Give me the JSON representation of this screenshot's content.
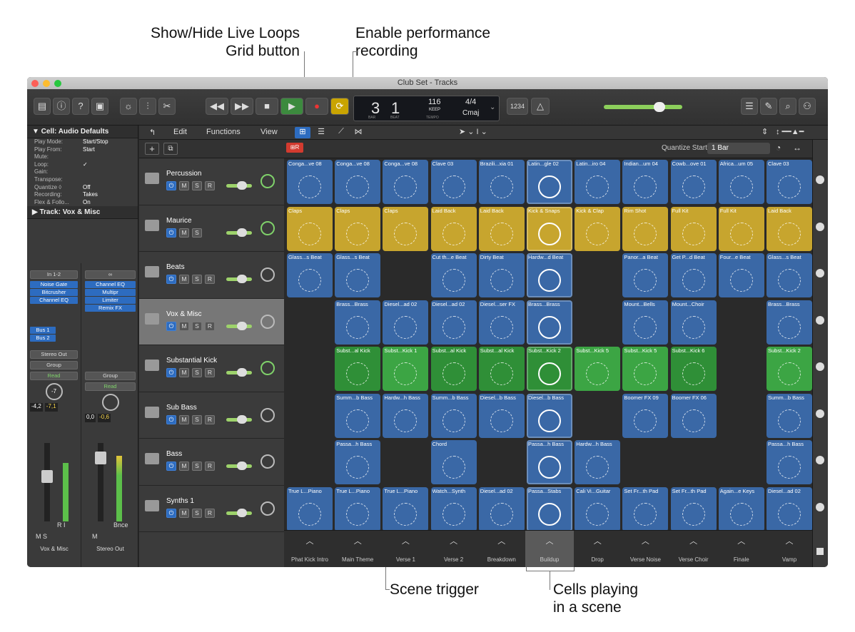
{
  "callouts": {
    "live_loops_grid": "Show/Hide Live Loops\nGrid button",
    "perf_record": "Enable performance\nrecording",
    "scene_trigger": "Scene trigger",
    "cells_playing": "Cells playing\nin a scene"
  },
  "window": {
    "title": "Club Set - Tracks"
  },
  "lcd": {
    "bar": "3",
    "beat": "1",
    "bar_lbl": "BAR",
    "beat_lbl": "BEAT",
    "tempo": "116",
    "keep": "KEEP",
    "tempo_lbl": "TEMPO",
    "sig": "4/4",
    "key": "Cmaj",
    "count": "1234"
  },
  "inspector": {
    "region_header": "▼ Cell: Audio Defaults",
    "rows": [
      {
        "k": "Play Mode:",
        "v": "Start/Stop"
      },
      {
        "k": "Play From:",
        "v": "Start"
      },
      {
        "k": "Mute:",
        "v": ""
      },
      {
        "k": "Loop:",
        "v": "✓"
      },
      {
        "k": "Gain:",
        "v": ""
      },
      {
        "k": "Transpose:",
        "v": ""
      },
      {
        "k": "Quantize ◊",
        "v": "Off"
      },
      {
        "k": "Recording:",
        "v": "Takes"
      },
      {
        "k": "Flex & Follo...",
        "v": "On"
      }
    ],
    "track_header": "▶ Track:  Vox & Misc",
    "ch1": {
      "input": "In 1-2",
      "plugins": [
        "Noise Gate",
        "Bitcrusher",
        "Channel EQ"
      ],
      "sends": [
        "Bus 1",
        "Bus 2"
      ],
      "output": "Stereo Out",
      "group": "Group",
      "auto": "Read",
      "pan": "-7",
      "lvl1": "-4,2",
      "lvl2": "-7,1",
      "name": "Vox & Misc",
      "ri": "R  I",
      "ms": "M  S"
    },
    "ch2": {
      "plugins": [
        "Channel EQ",
        "Multipr",
        "Limiter",
        "Remix FX"
      ],
      "group": "Group",
      "auto": "Read",
      "lvl1": "0,0",
      "lvl2": "-0,6",
      "name": "Stereo Out",
      "bnce": "Bnce",
      "m": "M"
    }
  },
  "menus": {
    "edit": "Edit",
    "functions": "Functions",
    "view": "View",
    "quantize_label": "Quantize Start:",
    "quantize_value": "1 Bar"
  },
  "tracks": [
    {
      "name": "Percussion"
    },
    {
      "name": "Maurice"
    },
    {
      "name": "Beats"
    },
    {
      "name": "Vox & Misc"
    },
    {
      "name": "Substantial Kick"
    },
    {
      "name": "Sub Bass"
    },
    {
      "name": "Bass"
    },
    {
      "name": "Synths 1"
    }
  ],
  "colors": {
    "blue": "#3a68a6",
    "yellow": "#c7a52e",
    "green": "#3ca544",
    "green_dark": "#2f8f37"
  },
  "grid": [
    [
      "Conga...ve 08",
      "Conga...ve 08",
      "Conga...ve 08",
      "Clave 03",
      "Brazili...xia 01",
      "Latin...gle 02",
      "Latin...iro 04",
      "Indian...um 04",
      "Cowb...ove 01",
      "Africa...um 05",
      "Clave 03"
    ],
    [
      "Claps",
      "Claps",
      "Claps",
      "Laid Back",
      "Laid Back",
      "Kick & Snaps",
      "Kick & Clap",
      "Rim Shot",
      "Full Kit",
      "Full Kit",
      "Laid Back"
    ],
    [
      "Glass...s Beat",
      "Glass...s Beat",
      "",
      "Cut th...e Beat",
      "Dirty Beat",
      "Hardw...d Beat",
      "",
      "Panor...a Beat",
      "Get P...d Beat",
      "Four...e Beat",
      "Glass...s Beat"
    ],
    [
      "",
      "Brass...Brass",
      "Diesel...ad 02",
      "Diesel...ad 02",
      "Diesel...ser FX",
      "Brass...Brass",
      "",
      "Mount...Bells",
      "Mount...Choir",
      "",
      "Brass...Brass"
    ],
    [
      "",
      "Subst...al Kick",
      "Subst...Kick 1",
      "Subst...al Kick",
      "Subst...al Kick",
      "Subst...Kick 2",
      "Subst...Kick 5",
      "Subst...Kick 5",
      "Subst...Kick 6",
      "",
      "Subst...Kick 2"
    ],
    [
      "",
      "Summ...b Bass",
      "Hardw...h Bass",
      "Summ...b Bass",
      "Diesel...b Bass",
      "Diesel...b Bass",
      "",
      "Boomer FX 09",
      "Boomer FX 06",
      "",
      "Summ...b Bass"
    ],
    [
      "",
      "Passa...h Bass",
      "",
      "Chord",
      "",
      "Passa...h Bass",
      "Hardw...h Bass",
      "",
      "",
      "",
      "Passa...h Bass"
    ],
    [
      "True L...Piano",
      "True L...Piano",
      "True L...Piano",
      "Watch...Synth",
      "Diesel...ad 02",
      "Passa...Stabs",
      "Cali Vi...Guitar",
      "Set Fr...th Pad",
      "Set Fr...th Pad",
      "Again...e Keys",
      "Diesel...ad 02"
    ]
  ],
  "scenes": [
    "Phat Kick Intro",
    "Main Theme",
    "Verse 1",
    "Verse 2",
    "Breakdown",
    "Buildup",
    "Drop",
    "Verse Noise",
    "Verse Choir",
    "Finale",
    "Vamp"
  ],
  "active_scene": 5
}
